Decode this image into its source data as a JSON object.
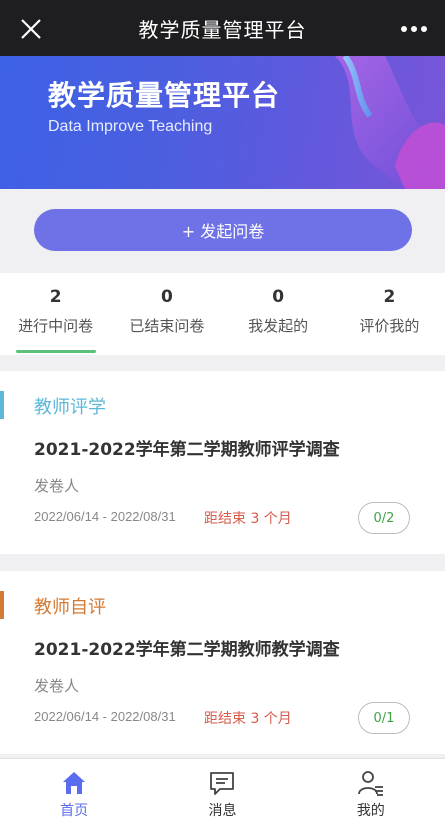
{
  "header": {
    "title": "教学质量管理平台",
    "close_icon": "close-icon",
    "more_icon": "more-dots-icon"
  },
  "banner": {
    "title": "教学质量管理平台",
    "subtitle": "Data Improve Teaching"
  },
  "actions": {
    "start_label": "+ 发起问卷"
  },
  "tabs": [
    {
      "count": "2",
      "label": "进行中问卷",
      "active": true
    },
    {
      "count": "0",
      "label": "已结束问卷"
    },
    {
      "count": "0",
      "label": "我发起的"
    },
    {
      "count": "2",
      "label": "评价我的"
    }
  ],
  "surveys": [
    {
      "category": "教师评学",
      "category_color": "#5bb8d8",
      "title": "2021-2022学年第二学期教师评学调查",
      "sender_label": "发卷人",
      "date_range": "2022/06/14 - 2022/08/31",
      "remaining": "距结束 3 个月",
      "progress": "0/2"
    },
    {
      "category": "教师自评",
      "category_color": "#d47a34",
      "title": "2021-2022学年第二学期教师教学调查",
      "sender_label": "发卷人",
      "date_range": "2022/06/14 - 2022/08/31",
      "remaining": "距结束 3 个月",
      "progress": "0/1"
    }
  ],
  "nav": [
    {
      "label": "首页",
      "icon": "home-icon",
      "active": true
    },
    {
      "label": "消息",
      "icon": "message-icon"
    },
    {
      "label": "我的",
      "icon": "profile-icon"
    }
  ],
  "colors": {
    "accent": "#6f72e6",
    "tab_underline": "#5cc27a",
    "remaining": "#d65a4a",
    "progress": "#43a047"
  }
}
